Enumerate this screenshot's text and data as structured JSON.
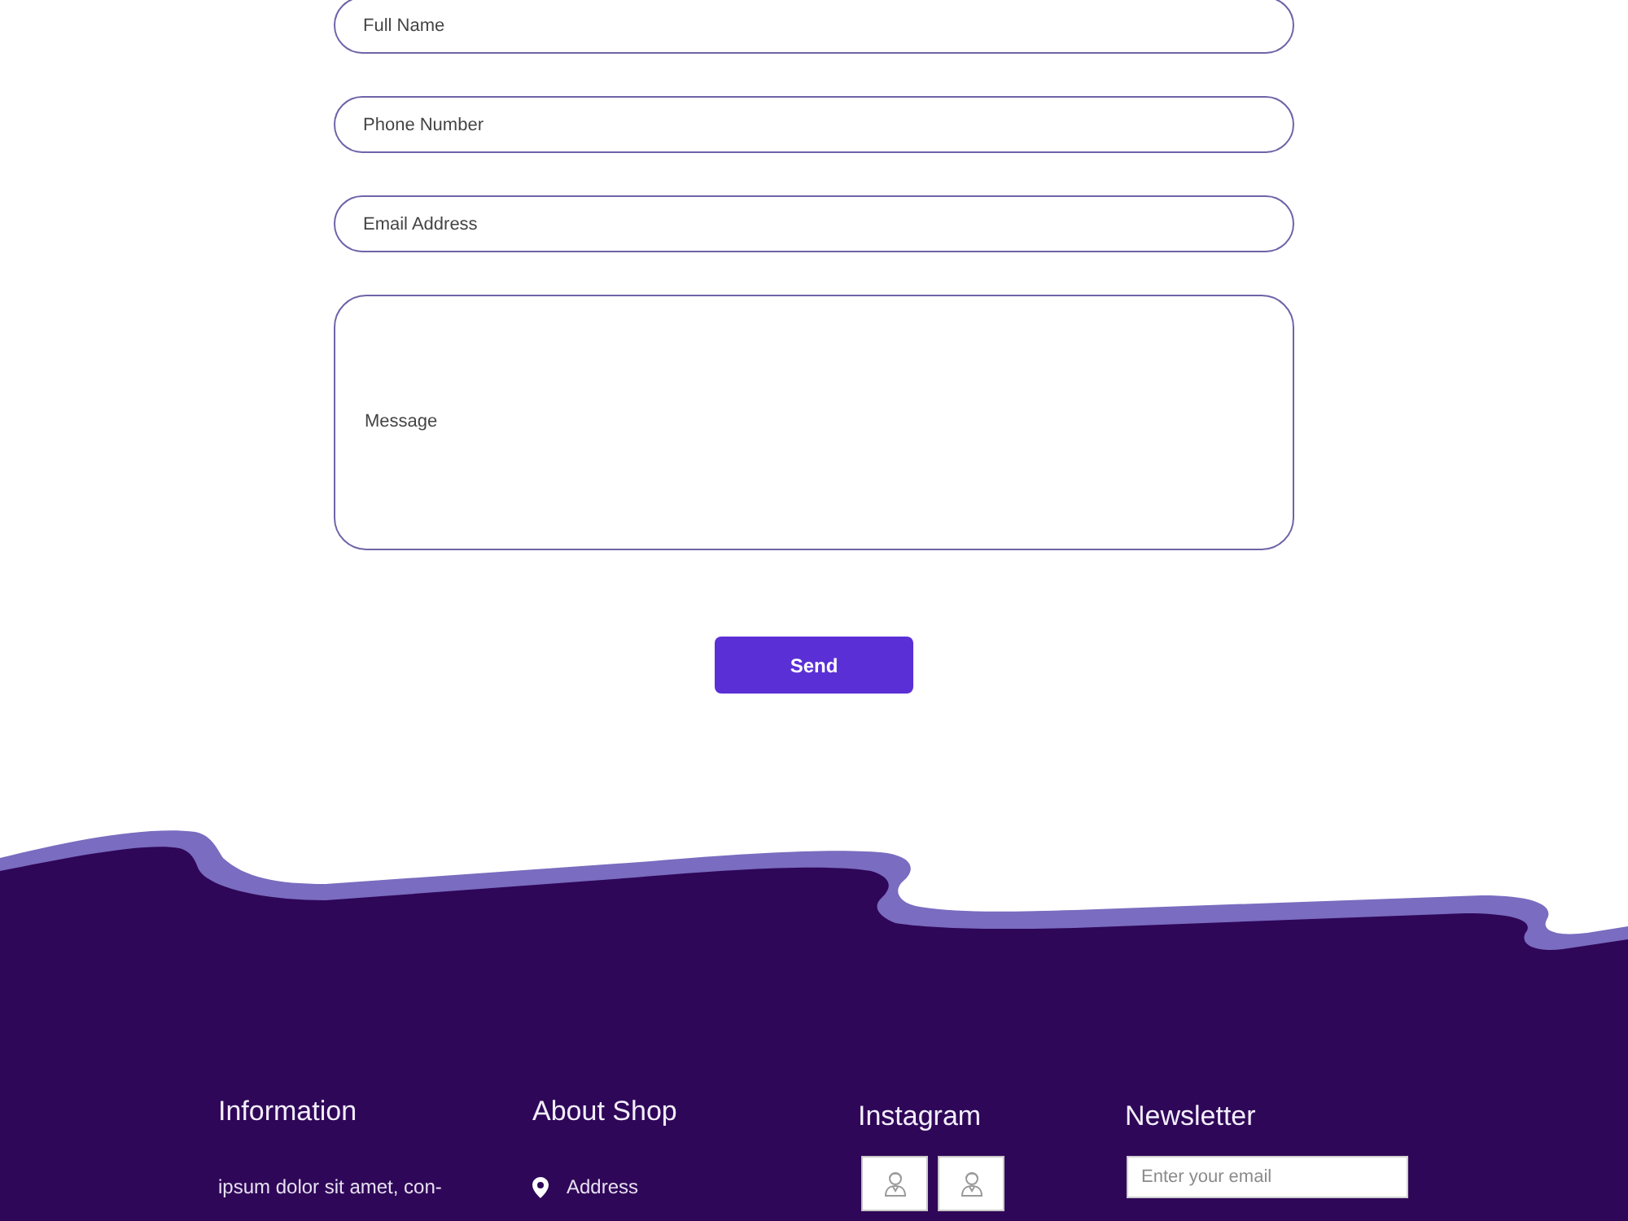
{
  "form": {
    "fields": [
      {
        "kind": "input",
        "placeholder": "Full Name"
      },
      {
        "kind": "input",
        "placeholder": "Phone Number"
      },
      {
        "kind": "input",
        "placeholder": "Email Address"
      },
      {
        "kind": "textarea",
        "placeholder": "Message"
      }
    ],
    "button": "Send"
  },
  "footer": {
    "columns": [
      {
        "kind": "text",
        "heading": "Information",
        "text": "ipsum dolor sit amet, con-"
      },
      {
        "kind": "contacts",
        "heading": "About Shop",
        "items": [
          {
            "label": "Address"
          }
        ]
      },
      {
        "kind": "gallery",
        "heading": "Instagram"
      },
      {
        "kind": "newsletter",
        "heading": "Newsletter",
        "placeholder": "Enter your email"
      }
    ]
  }
}
